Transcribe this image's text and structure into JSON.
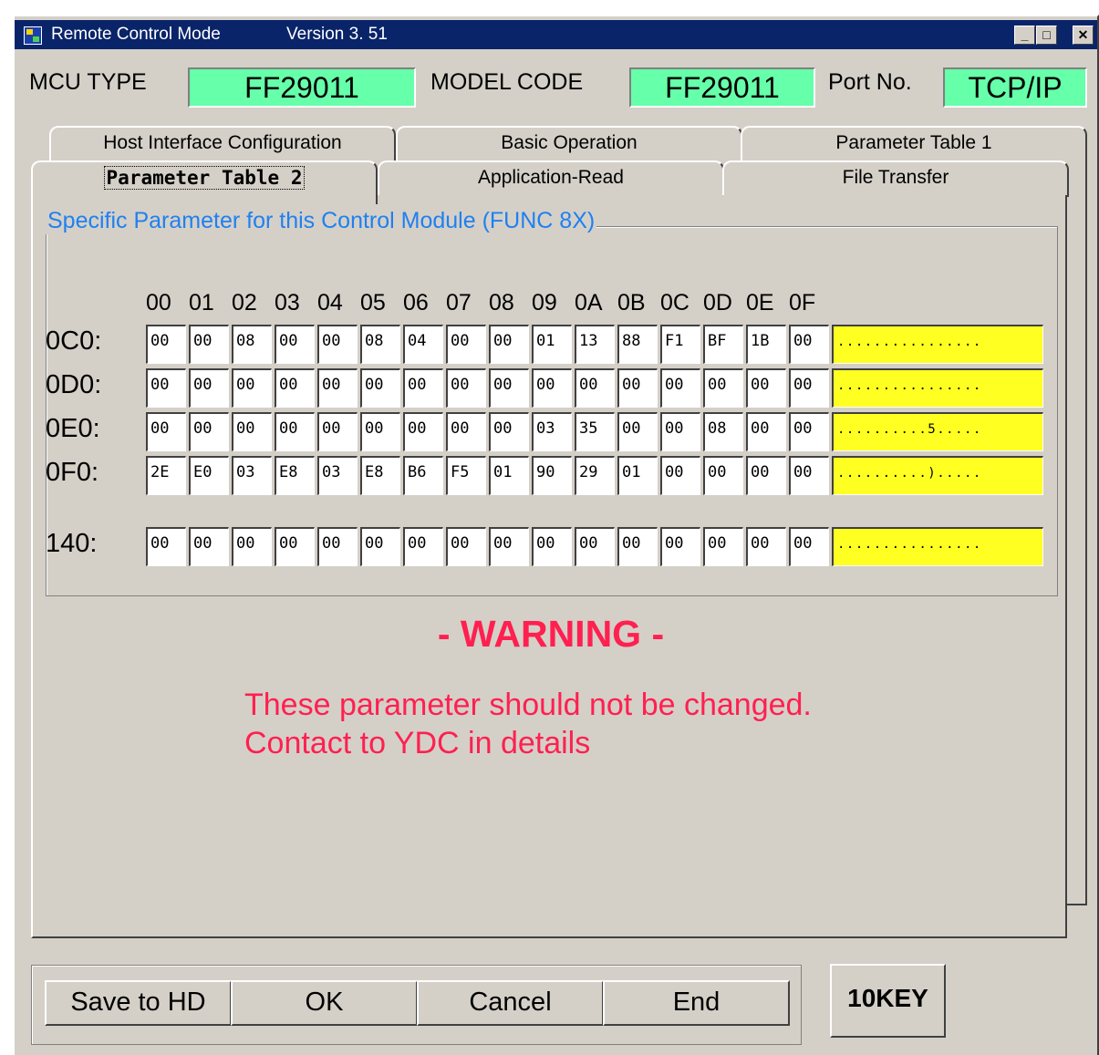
{
  "window": {
    "title": "Remote Control Mode",
    "version": "Version  3. 51",
    "minimize": "_",
    "maximize": "□",
    "close": "✕"
  },
  "header": {
    "mcu_type_label": "MCU TYPE",
    "mcu_type_value": "FF29011",
    "model_code_label": "MODEL CODE",
    "model_code_value": "FF29011",
    "port_label": "Port No.",
    "port_value": "TCP/IP"
  },
  "tabs": {
    "row_back": [
      "Host Interface Configuration",
      "Basic Operation",
      "Parameter Table 1"
    ],
    "row_front": [
      "Parameter Table 2",
      "Application-Read",
      "File Transfer"
    ],
    "active": "Parameter Table 2"
  },
  "group_title": "Specific Parameter for this Control Module (FUNC 8X)",
  "columns": [
    "00",
    "01",
    "02",
    "03",
    "04",
    "05",
    "06",
    "07",
    "08",
    "09",
    "0A",
    "0B",
    "0C",
    "0D",
    "0E",
    "0F"
  ],
  "rows": [
    {
      "label": "0C0:",
      "cells": [
        "00",
        "00",
        "08",
        "00",
        "00",
        "08",
        "04",
        "00",
        "00",
        "01",
        "13",
        "88",
        "F1",
        "BF",
        "1B",
        "00"
      ],
      "ascii": "................"
    },
    {
      "label": "0D0:",
      "cells": [
        "00",
        "00",
        "00",
        "00",
        "00",
        "00",
        "00",
        "00",
        "00",
        "00",
        "00",
        "00",
        "00",
        "00",
        "00",
        "00"
      ],
      "ascii": "................"
    },
    {
      "label": "0E0:",
      "cells": [
        "00",
        "00",
        "00",
        "00",
        "00",
        "00",
        "00",
        "00",
        "00",
        "03",
        "35",
        "00",
        "00",
        "08",
        "00",
        "00"
      ],
      "ascii": "..........5....."
    },
    {
      "label": "0F0:",
      "cells": [
        "2E",
        "E0",
        "03",
        "E8",
        "03",
        "E8",
        "B6",
        "F5",
        "01",
        "90",
        "29",
        "01",
        "00",
        "00",
        "00",
        "00"
      ],
      "ascii": "..........)....."
    },
    {
      "label": "140:",
      "cells": [
        "00",
        "00",
        "00",
        "00",
        "00",
        "00",
        "00",
        "00",
        "00",
        "00",
        "00",
        "00",
        "00",
        "00",
        "00",
        "00"
      ],
      "ascii": "................"
    }
  ],
  "warning": {
    "title": "- WARNING -",
    "text": "These parameter should not be changed. Contact to YDC in details"
  },
  "buttons": {
    "save": "Save to HD",
    "ok": "OK",
    "cancel": "Cancel",
    "end": "End",
    "tenkey": "10KEY"
  },
  "colors": {
    "field_bg": "#66ffaa",
    "ascii_bg": "#ffff22",
    "warning": "#ff2050",
    "group_title": "#2080f0",
    "titlebar": "#0a246a"
  }
}
